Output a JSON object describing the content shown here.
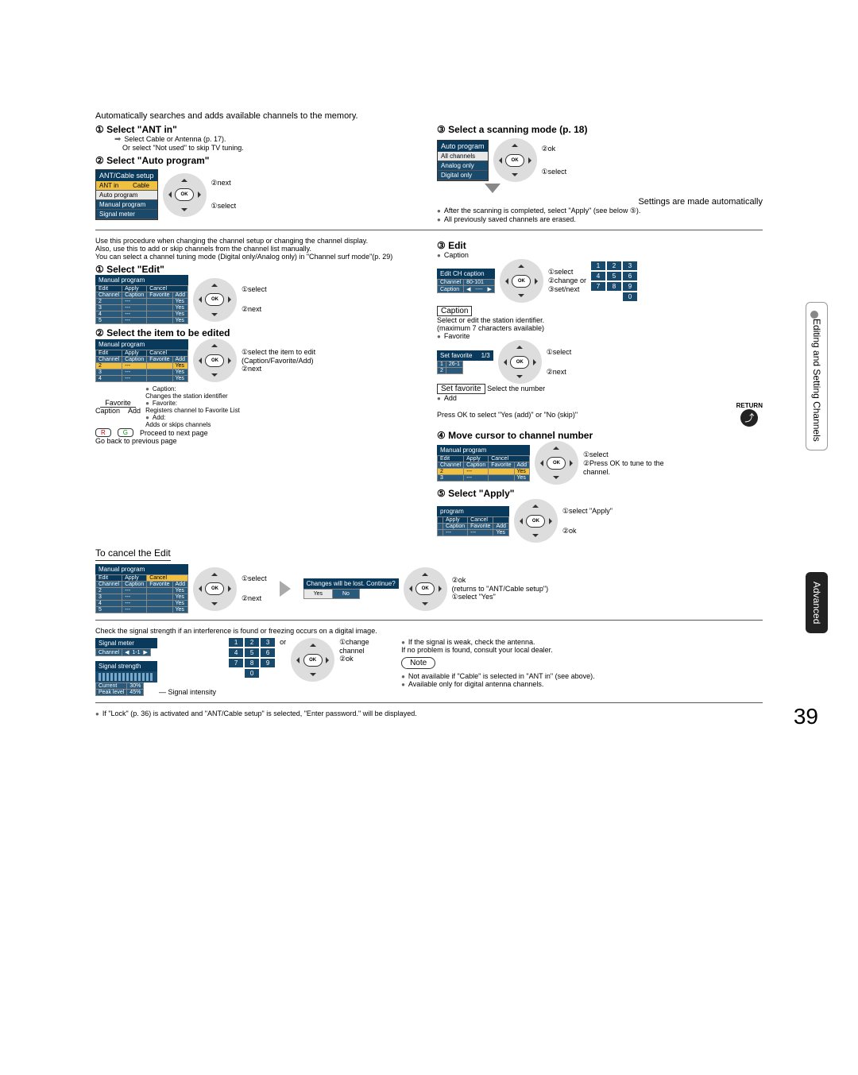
{
  "intro": "Automatically searches and adds available channels to the memory.",
  "step1": {
    "title": "① Select \"ANT in\"",
    "sub1": "Select Cable or Antenna (p. 17).",
    "sub2": "Or select \"Not used\" to skip TV tuning."
  },
  "step2": {
    "title": "② Select \"Auto program\""
  },
  "antCableSetup": {
    "header": "ANT/Cable setup",
    "r1a": "ANT in",
    "r1b": "Cable",
    "r2": "Auto program",
    "r3": "Manual program",
    "r4": "Signal meter"
  },
  "navLabels": {
    "next": "②next",
    "select": "①select",
    "ok": "②ok",
    "change": "①change",
    "changeOr": "②change or",
    "setNext": "③set/next",
    "selectItem": "①select the item to edit (Caption/Favorite/Add)",
    "pressOk": "②Press OK to tune to the channel.",
    "selectApply": "①select \"Apply\"",
    "returnsTo": "(returns to \"ANT/Cable setup\")",
    "selectYes": "①select \"Yes\"",
    "changeChannel": "①change channel"
  },
  "step3": {
    "title": "③ Select a scanning mode (p. 18)"
  },
  "autoProgram": {
    "header": "Auto program",
    "opt1": "All channels",
    "opt2": "Analog only",
    "opt3": "Digital only"
  },
  "settingsAuto": "Settings are made automatically",
  "bulletsA": {
    "b1": "After the scanning is completed, select \"Apply\" (see below ⑤).",
    "b2": "All previously saved channels are erased."
  },
  "manualIntro": {
    "p1": "Use this procedure when changing the channel setup or changing the channel display.",
    "p2": "Also, use this to add or skip channels from the channel list manually.",
    "p3": "You can select a channel tuning mode (Digital only/Analog only) in \"Channel surf mode\"(p. 29)"
  },
  "stepEdit1": "① Select \"Edit\"",
  "stepEdit2": "② Select the item to be edited",
  "manualProgramHeader": "Manual program",
  "tableCols": {
    "edit": "Edit",
    "apply": "Apply",
    "cancel": "Cancel",
    "channel": "Channel",
    "caption": "Caption",
    "favorite": "Favorite",
    "add": "Add"
  },
  "tableRows": {
    "yes": "Yes",
    "dash": "---"
  },
  "favLabel": "Favorite",
  "capLabel": "Caption",
  "addLabel": "Add",
  "captionDesc": "Changes the station identifier",
  "captionHead": "Caption:",
  "favoriteHead": "Favorite:",
  "favoriteDesc": "Registers channel to Favorite List",
  "addHead": "Add:",
  "addDesc": "Adds or skips channels",
  "rgLabel": "Proceed to next page",
  "goBack": "Go back to previous page",
  "r": "R",
  "g": "G",
  "edit3": "③ Edit",
  "captionBullet": "Caption",
  "editCHcaption": {
    "header": "Edit CH caption",
    "channel": "Channel",
    "chVal": "80-101",
    "caption": "Caption",
    "capVal": "----"
  },
  "captionBox": "Caption",
  "captionDesc2a": "Select or edit the station identifier.",
  "captionDesc2b": "(maximum 7 characters available)",
  "favBullet": "Favorite",
  "setFav": {
    "header": "Set favorite",
    "page": "1/3",
    "r1": "1",
    "r1v": "26-1",
    "r2": "2"
  },
  "setFavBox": "Set favorite",
  "setFavDesc": "Select the number",
  "addBullet": "Add",
  "addDesc2": "Press OK to select \"Yes (add)\" or \"No (skip)\"",
  "returnLabel": "RETURN",
  "move4": "④ Move cursor to channel number",
  "select5": "⑤ Select \"Apply\"",
  "programHeader": "program",
  "cancelEdit": "To cancel the Edit",
  "dialog": {
    "header": "Changes will be lost. Continue?",
    "yes": "Yes",
    "no": "No"
  },
  "signalIntro": "Check the signal strength if an interference is found or freezing occurs on a digital image.",
  "signalMeter": {
    "header": "Signal meter",
    "channel": "Channel",
    "chVal": "1-1",
    "strength": "Signal strength",
    "current": "Current",
    "curVal": "30%",
    "peak": "Peak level",
    "peakVal": "45%"
  },
  "signalIntensity": "Signal intensity",
  "or": "or",
  "signalBullets": {
    "b1": "If the signal is weak, check the antenna.",
    "b1b": "If no problem is found, consult your local dealer.",
    "b2": "Not available if \"Cable\" is selected in \"ANT in\" (see above).",
    "b3": "Available only for digital antenna channels."
  },
  "noteLabel": "Note",
  "footnote": "If \"Lock\" (p. 36) is activated and \"ANT/Cable setup\" is selected, \"Enter password.\" will be displayed.",
  "pageNum": "39",
  "sideTab1": "Editing and Setting Channels",
  "sideTab2": "Advanced",
  "keypad": {
    "k1": "1",
    "k2": "2",
    "k3": "3",
    "k4": "4",
    "k5": "5",
    "k6": "6",
    "k7": "7",
    "k8": "8",
    "k9": "9",
    "k0": "0"
  }
}
